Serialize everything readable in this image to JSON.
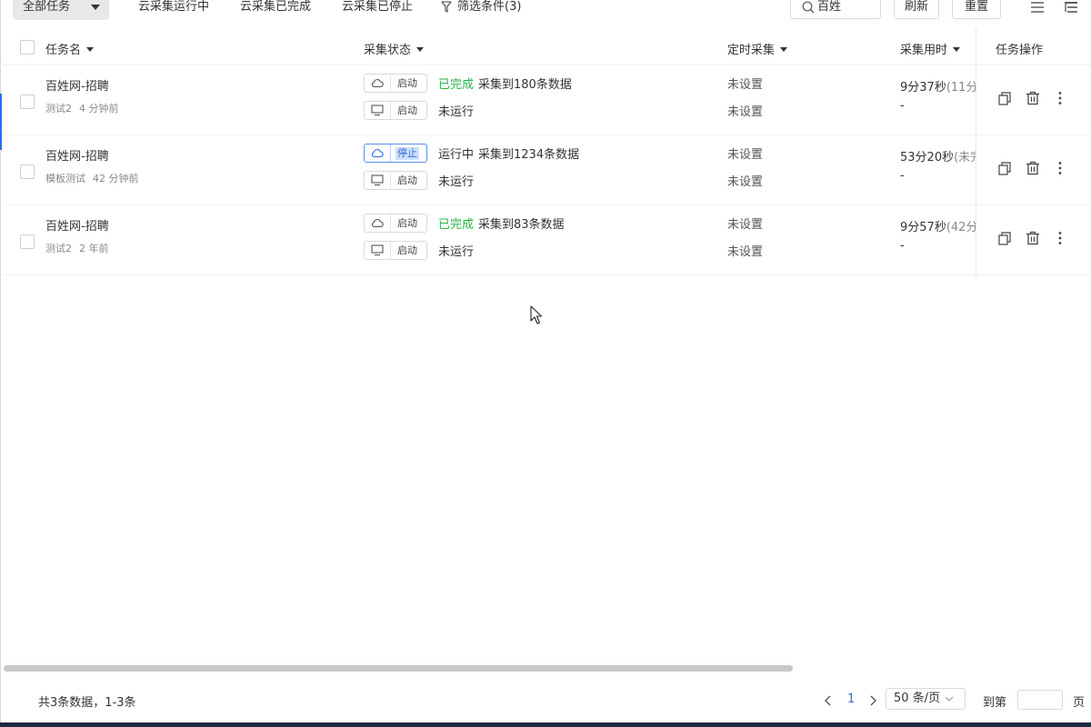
{
  "toolbar": {
    "all_tasks_label": "全部任务",
    "tab_cloud_running": "云采集运行中",
    "tab_cloud_done": "云采集已完成",
    "tab_cloud_stopped": "云采集已停止",
    "filter_label": "筛选条件(3)",
    "search_value": "百姓",
    "refresh_label": "刷新",
    "reset_label": "重置"
  },
  "table": {
    "columns": {
      "task_name": "任务名",
      "collect_status": "采集状态",
      "scheduled": "定时采集",
      "time_used": "采集用时",
      "task_ops": "任务操作"
    },
    "rows": [
      {
        "name": "百姓网-招聘",
        "group": "测试2",
        "time_ago": "4 分钟前",
        "cloud_btn": "启动",
        "local_btn": "启动",
        "cloud_status": "已完成",
        "cloud_result": "采集到180条数据",
        "local_status": "未运行",
        "cloud_schedule": "未设置",
        "local_schedule": "未设置",
        "duration": "9分37秒",
        "duration_extra": "(11分",
        "local_duration": "-"
      },
      {
        "name": "百姓网-招聘",
        "group": "模板测试",
        "time_ago": "42 分钟前",
        "cloud_btn": "停止",
        "local_btn": "启动",
        "cloud_status": "运行中",
        "cloud_result": "采集到1234条数据",
        "local_status": "未运行",
        "cloud_schedule": "未设置",
        "local_schedule": "未设置",
        "duration": "53分20秒",
        "duration_extra": "(未完",
        "local_duration": "-"
      },
      {
        "name": "百姓网-招聘",
        "group": "测试2",
        "time_ago": "2 年前",
        "cloud_btn": "启动",
        "local_btn": "启动",
        "cloud_status": "已完成",
        "cloud_result": "采集到83条数据",
        "local_status": "未运行",
        "cloud_schedule": "未设置",
        "local_schedule": "未设置",
        "duration": "9分57秒",
        "duration_extra": "(42分",
        "local_duration": "-"
      }
    ]
  },
  "footer": {
    "total_text": "共3条数据，1-3条",
    "current_page": "1",
    "page_size": "50 条/页",
    "jump_label": "到第",
    "page_suffix": "页"
  },
  "colors": {
    "success": "#2db24a",
    "accent": "#2f6de1",
    "border": "#d9d9d9"
  },
  "icons": [
    "chevron-down-icon",
    "filter-icon",
    "search-icon",
    "list-view-icon",
    "tree-view-icon",
    "cloud-icon",
    "monitor-icon",
    "copy-icon",
    "trash-icon",
    "more-icon",
    "prev-page-icon",
    "next-page-icon"
  ]
}
